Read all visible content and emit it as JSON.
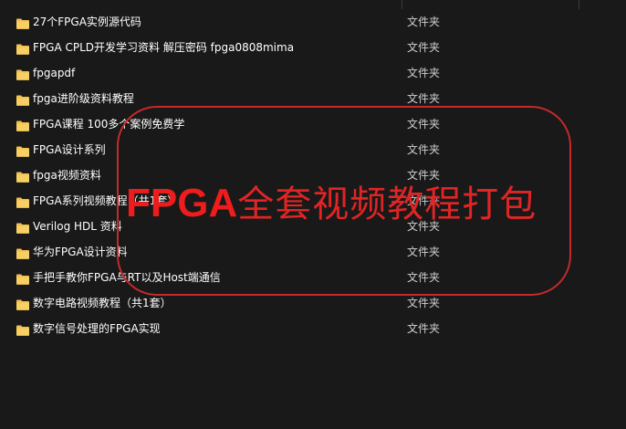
{
  "file_list": {
    "items": [
      {
        "name": "27个FPGA实例源代码",
        "type": "文件夹",
        "icon": "folder-icon"
      },
      {
        "name": "FPGA CPLD开发学习资料 解压密码 fpga0808mima",
        "type": "文件夹",
        "icon": "folder-icon"
      },
      {
        "name": "fpgapdf",
        "type": "文件夹",
        "icon": "folder-icon"
      },
      {
        "name": "fpga进阶级资料教程",
        "type": "文件夹",
        "icon": "folder-icon"
      },
      {
        "name": "FPGA课程 100多个案例免费学",
        "type": "文件夹",
        "icon": "folder-icon"
      },
      {
        "name": "FPGA设计系列",
        "type": "文件夹",
        "icon": "folder-icon"
      },
      {
        "name": "fpga视频资料",
        "type": "文件夹",
        "icon": "folder-icon"
      },
      {
        "name": "FPGA系列视频教程（共1套）",
        "type": "文件夹",
        "icon": "folder-icon"
      },
      {
        "name": "Verilog HDL 资料",
        "type": "文件夹",
        "icon": "folder-icon"
      },
      {
        "name": "华为FPGA设计资料",
        "type": "文件夹",
        "icon": "folder-icon"
      },
      {
        "name": "手把手教你FPGA与RT以及Host端通信",
        "type": "文件夹",
        "icon": "folder-icon"
      },
      {
        "name": "数字电路视频教程（共1套）",
        "type": "文件夹",
        "icon": "folder-icon"
      },
      {
        "name": "数字信号处理的FPGA实现",
        "type": "文件夹",
        "icon": "folder-icon"
      }
    ]
  },
  "overlay": {
    "latin": "FPGA",
    "cjk": "全套视频教程打包",
    "color": "#e12424"
  },
  "colors": {
    "background": "#191919",
    "folder": "#f2c14e",
    "type_text": "#cfcfcf"
  }
}
